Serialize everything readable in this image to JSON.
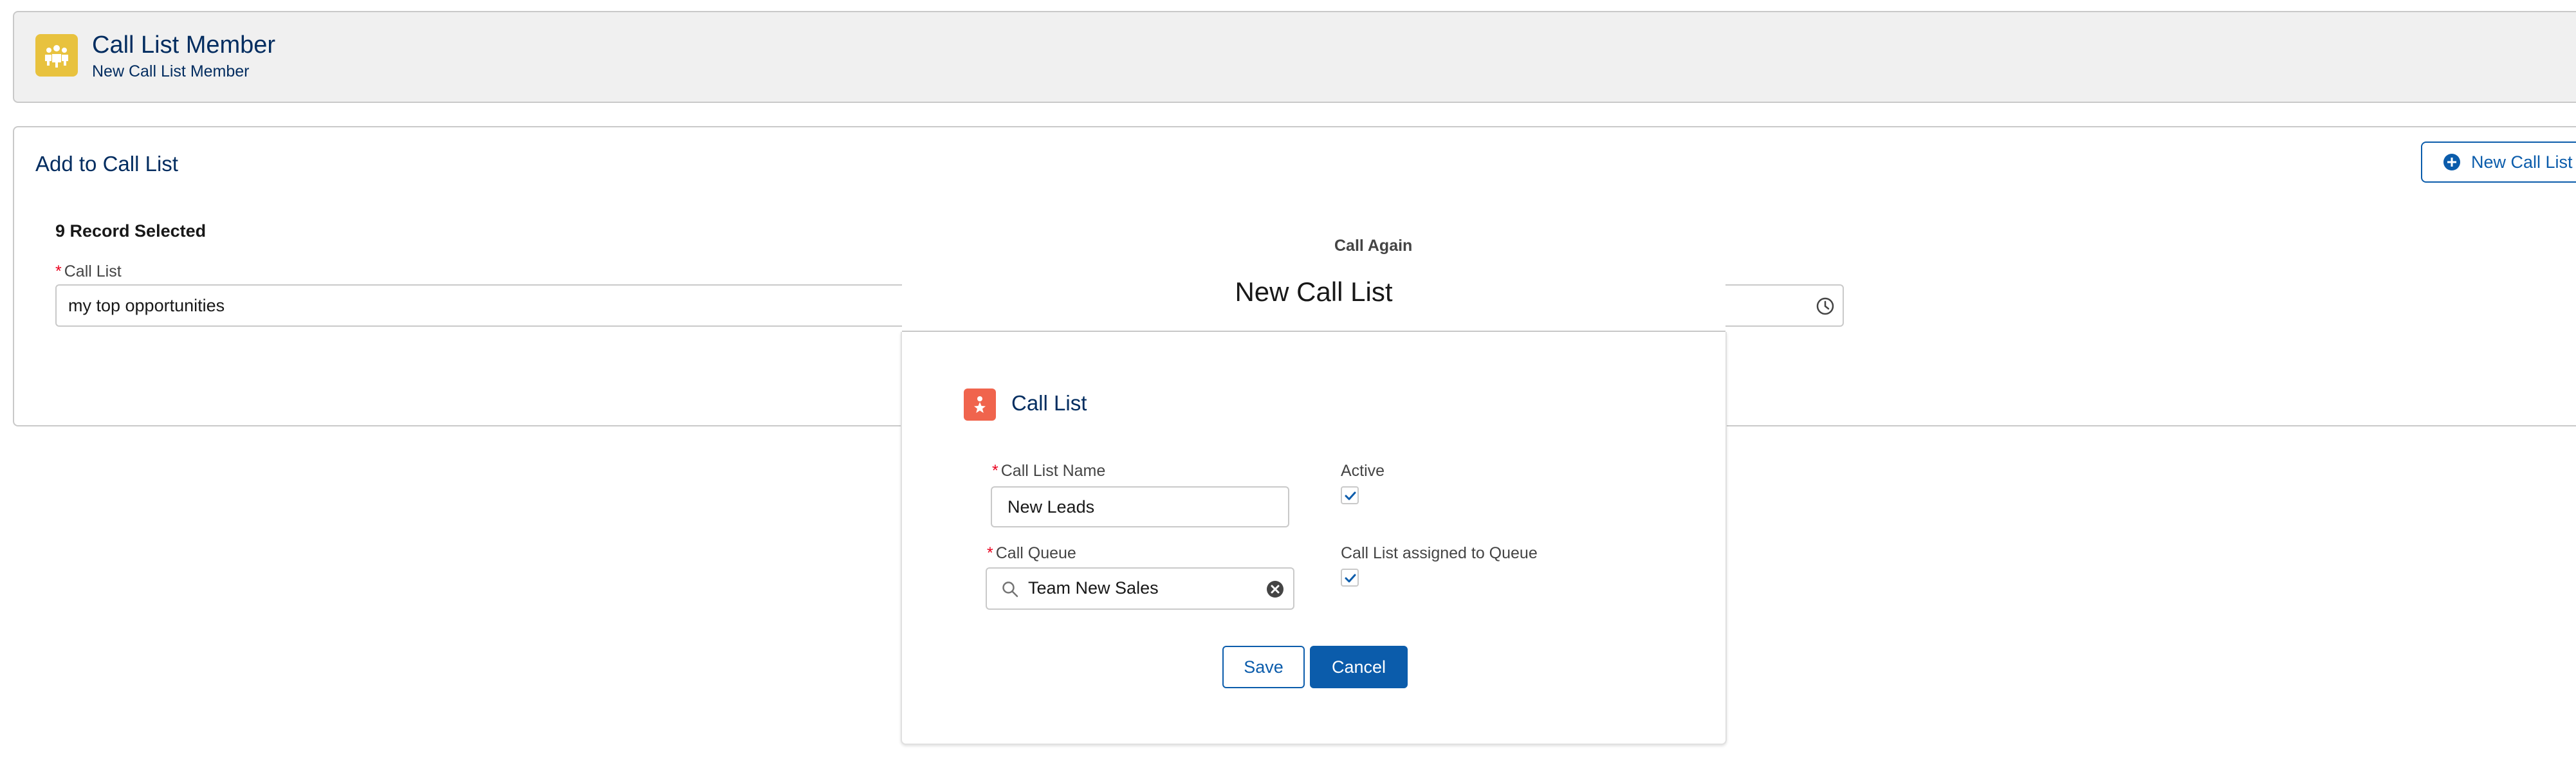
{
  "header": {
    "title": "Call List Member",
    "subtitle": "New Call List Member",
    "icon": "call-list-member-icon",
    "icon_color": "#e8c23e"
  },
  "card": {
    "title": "Add to Call List",
    "new_call_list_button": "New Call List",
    "selected_count": "9 Record Selected",
    "call_list_label": "Call List",
    "call_list_value": "my top opportunities",
    "call_again_label": "Call Again"
  },
  "modal": {
    "title": "New Call List",
    "record_type": "Call List",
    "record_icon_color": "#f0644d",
    "fields": {
      "name_label": "Call List Name",
      "name_value": "New Leads",
      "active_label": "Active",
      "active_checked": true,
      "queue_label": "Call Queue",
      "queue_value": "Team New Sales",
      "assigned_label": "Call List assigned to Queue",
      "assigned_checked": true
    },
    "save_label": "Save",
    "cancel_label": "Cancel"
  },
  "colors": {
    "brand_blue": "#0b5cab",
    "title_navy": "#032d60",
    "required_red": "#ea001e"
  }
}
